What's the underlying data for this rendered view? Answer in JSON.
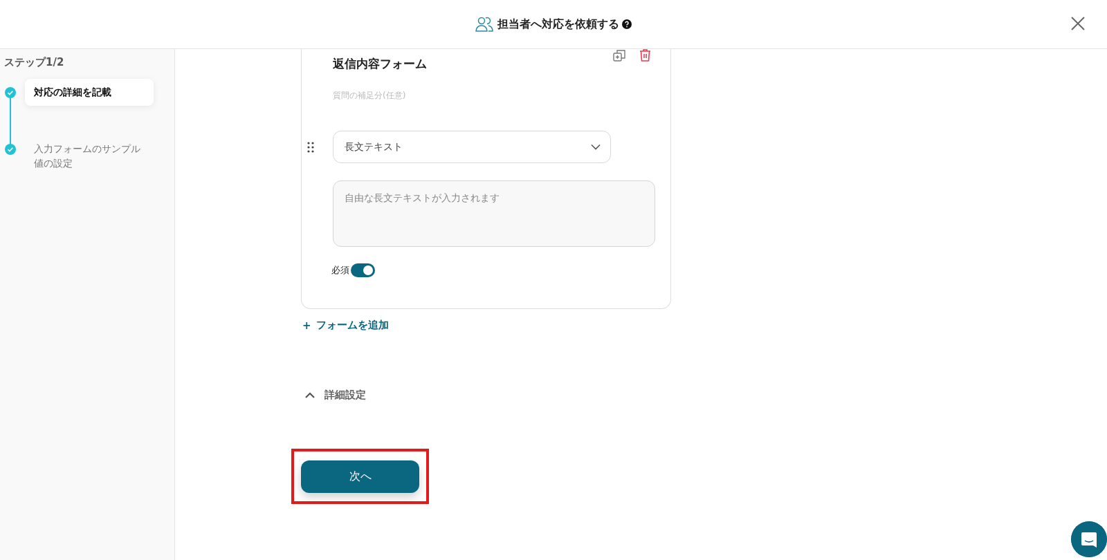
{
  "header": {
    "title": "担当者へ対応を依頼する"
  },
  "sidebar": {
    "step_label": "ステップ1/2",
    "steps": [
      {
        "label": "対応の詳細を記載",
        "selected": true,
        "completed": true
      },
      {
        "label": "入力フォームのサンプル値の設定",
        "selected": false,
        "completed": true
      }
    ]
  },
  "form_card": {
    "title": "返信内容フォーム",
    "description_placeholder": "質問の補足分(任意)",
    "type_select": {
      "value": "長文テキスト"
    },
    "answer_placeholder": "自由な長文テキストが入力されます",
    "required": {
      "label": "必須",
      "on": true
    }
  },
  "add_form": {
    "icon": "+",
    "label": "フォームを追加"
  },
  "details": {
    "label": "詳細設定",
    "expanded": true
  },
  "next_button": {
    "label": "次へ",
    "highlighted": true
  }
}
